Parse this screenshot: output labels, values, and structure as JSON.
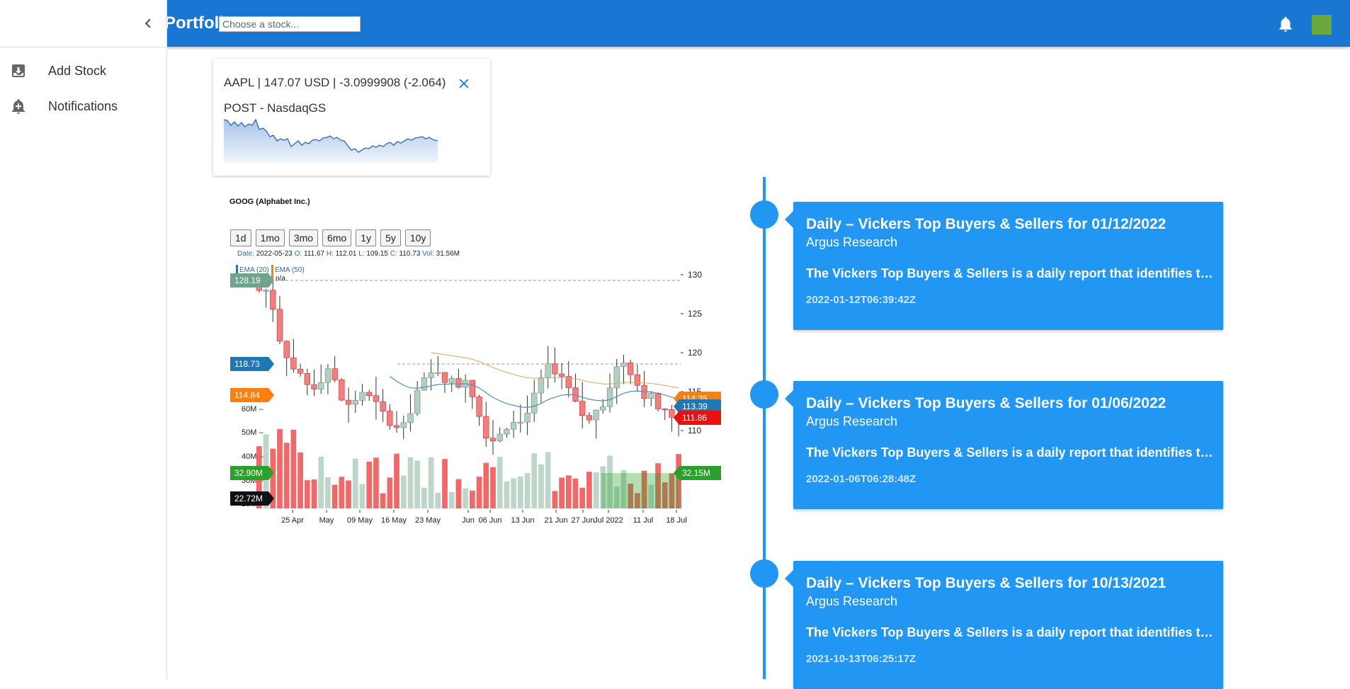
{
  "appbar": {
    "title": "Portfolio",
    "search_placeholder": "Choose a stock...",
    "bell_icon": "notifications-bell-icon",
    "avatar_color": "#6aa73f",
    "accent": "#1976d2"
  },
  "drawer": {
    "collapse_icon": "chevron-left-icon",
    "items": [
      {
        "label": "Add Stock",
        "icon": "add-box-icon"
      },
      {
        "label": "Notifications",
        "icon": "add-alert-icon"
      }
    ]
  },
  "stock_card": {
    "line1": "AAPL | 147.07 USD | -3.0999908 (-2.064)",
    "line2": "POST - NasdaqGS",
    "close_icon": "close-icon"
  },
  "chart": {
    "title": "GOOG (Alphabet Inc.)",
    "ranges": [
      "1d",
      "1mo",
      "3mo",
      "6mo",
      "1y",
      "5y",
      "10y"
    ],
    "ohlc": {
      "date_label": "Date:",
      "date": "2022-05-23",
      "o_label": "O:",
      "o": "111.67",
      "h_label": "H:",
      "h": "112.01",
      "l_label": "L:",
      "l": "109.15",
      "c_label": "C:",
      "c": "110.73",
      "vol_label": "Vol:",
      "vol": "31.56M"
    },
    "ema_labels": [
      "EMA (20)",
      "EMA (50)"
    ],
    "ema_value": "n/a",
    "price_ticks": [
      "130",
      "125",
      "120",
      "115",
      "110"
    ],
    "volume_ticks": [
      "60M",
      "50M",
      "40M",
      "30M",
      "20M"
    ],
    "x_labels": [
      "25 Apr",
      "May",
      "09 May",
      "16 May",
      "23 May",
      "Jun",
      "06 Jun",
      "13 Jun",
      "21 Jun",
      "27 Jun",
      "Jul 2022",
      "11 Jul",
      "18 Jul"
    ],
    "left_badges": [
      {
        "text": "128.19",
        "color": "#6fa58a"
      },
      {
        "text": "118.73",
        "color": "#1f77b4"
      },
      {
        "text": "114.84",
        "color": "#ff7f0e"
      },
      {
        "text": "32.90M",
        "color": "#2ca02c"
      },
      {
        "text": "22.72M",
        "color": "#111111"
      }
    ],
    "right_badges": [
      {
        "text": "114.35",
        "color": "#ff7f0e"
      },
      {
        "text": "113.39",
        "color": "#1f77b4"
      },
      {
        "text": "111.86",
        "color": "#e81010"
      },
      {
        "text": "32.15M",
        "color": "#2ca02c"
      }
    ]
  },
  "timeline": [
    {
      "title": "Daily – Vickers Top Buyers & Sellers for 01/12/2022",
      "source": "Argus Research",
      "desc": "The Vickers Top Buyers & Sellers is a daily report that identifies the...",
      "time": "2022-01-12T06:39:42Z"
    },
    {
      "title": "Daily – Vickers Top Buyers & Sellers for 01/06/2022",
      "source": "Argus Research",
      "desc": "The Vickers Top Buyers & Sellers is a daily report that identifies the...",
      "time": "2022-01-06T06:28:48Z"
    },
    {
      "title": "Daily – Vickers Top Buyers & Sellers for 10/13/2021",
      "source": "Argus Research",
      "desc": "The Vickers Top Buyers & Sellers is a daily report that identifies the...",
      "time": "2021-10-13T06:25:17Z"
    }
  ]
}
